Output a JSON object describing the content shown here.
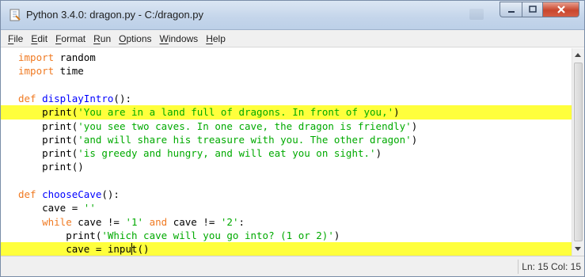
{
  "window": {
    "title": "Python 3.4.0: dragon.py - C:/dragon.py"
  },
  "menu": [
    "File",
    "Edit",
    "Format",
    "Run",
    "Options",
    "Windows",
    "Help"
  ],
  "editor": {
    "lines": [
      {
        "highlight": false,
        "tokens": [
          {
            "t": "kw",
            "v": "import"
          },
          {
            "t": "txt",
            "v": " random"
          }
        ]
      },
      {
        "highlight": false,
        "tokens": [
          {
            "t": "kw",
            "v": "import"
          },
          {
            "t": "txt",
            "v": " time"
          }
        ]
      },
      {
        "highlight": false,
        "tokens": []
      },
      {
        "highlight": false,
        "tokens": [
          {
            "t": "kw",
            "v": "def"
          },
          {
            "t": "txt",
            "v": " "
          },
          {
            "t": "def",
            "v": "displayIntro"
          },
          {
            "t": "txt",
            "v": "():"
          }
        ]
      },
      {
        "highlight": true,
        "tokens": [
          {
            "t": "txt",
            "v": "    print("
          },
          {
            "t": "str",
            "v": "'You are in a land full of dragons. In front of you,'"
          },
          {
            "t": "txt",
            "v": ")"
          }
        ]
      },
      {
        "highlight": false,
        "tokens": [
          {
            "t": "txt",
            "v": "    print("
          },
          {
            "t": "str",
            "v": "'you see two caves. In one cave, the dragon is friendly'"
          },
          {
            "t": "txt",
            "v": ")"
          }
        ]
      },
      {
        "highlight": false,
        "tokens": [
          {
            "t": "txt",
            "v": "    print("
          },
          {
            "t": "str",
            "v": "'and will share his treasure with you. The other dragon'"
          },
          {
            "t": "txt",
            "v": ")"
          }
        ]
      },
      {
        "highlight": false,
        "tokens": [
          {
            "t": "txt",
            "v": "    print("
          },
          {
            "t": "str",
            "v": "'is greedy and hungry, and will eat you on sight.'"
          },
          {
            "t": "txt",
            "v": ")"
          }
        ]
      },
      {
        "highlight": false,
        "tokens": [
          {
            "t": "txt",
            "v": "    print()"
          }
        ]
      },
      {
        "highlight": false,
        "tokens": []
      },
      {
        "highlight": false,
        "tokens": [
          {
            "t": "kw",
            "v": "def"
          },
          {
            "t": "txt",
            "v": " "
          },
          {
            "t": "def",
            "v": "chooseCave"
          },
          {
            "t": "txt",
            "v": "():"
          }
        ]
      },
      {
        "highlight": false,
        "tokens": [
          {
            "t": "txt",
            "v": "    cave = "
          },
          {
            "t": "str",
            "v": "''"
          }
        ]
      },
      {
        "highlight": false,
        "tokens": [
          {
            "t": "txt",
            "v": "    "
          },
          {
            "t": "kw",
            "v": "while"
          },
          {
            "t": "txt",
            "v": " cave != "
          },
          {
            "t": "str",
            "v": "'1'"
          },
          {
            "t": "txt",
            "v": " "
          },
          {
            "t": "kw",
            "v": "and"
          },
          {
            "t": "txt",
            "v": " cave != "
          },
          {
            "t": "str",
            "v": "'2'"
          },
          {
            "t": "txt",
            "v": ":"
          }
        ]
      },
      {
        "highlight": false,
        "tokens": [
          {
            "t": "txt",
            "v": "        print("
          },
          {
            "t": "str",
            "v": "'Which cave will you go into? (1 or 2)'"
          },
          {
            "t": "txt",
            "v": ")"
          }
        ]
      },
      {
        "highlight": true,
        "cursor_after": 4,
        "tokens": [
          {
            "t": "txt",
            "v": "        cave = inpu"
          },
          {
            "t": "txt",
            "v": "t()"
          }
        ]
      }
    ]
  },
  "statusbar": {
    "position": "Ln: 15 Col: 15"
  },
  "colors": {
    "keyword": "#f07a22",
    "defname": "#0000ff",
    "string": "#00aa00",
    "highlight": "#ffff3c"
  }
}
